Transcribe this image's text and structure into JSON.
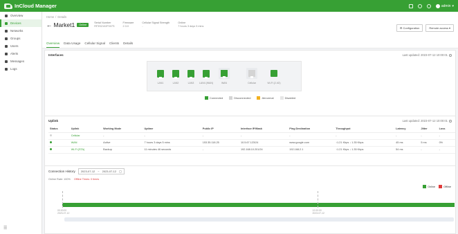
{
  "app": {
    "name": "InCloud Manager",
    "user": "admin"
  },
  "sidebar": {
    "items": [
      {
        "label": "Overview",
        "icon": "dashboard-icon",
        "active": false
      },
      {
        "label": "Devices",
        "icon": "devices-icon",
        "active": true
      },
      {
        "label": "Networks",
        "icon": "network-icon",
        "active": false
      },
      {
        "label": "Groups",
        "icon": "groups-icon",
        "active": false
      },
      {
        "label": "Users",
        "icon": "users-icon",
        "active": false
      },
      {
        "label": "Alerts",
        "icon": "alert-icon",
        "active": false
      },
      {
        "label": "Messages",
        "icon": "message-icon",
        "active": false
      },
      {
        "label": "Logs",
        "icon": "log-icon",
        "active": false
      }
    ],
    "collapse": "☰"
  },
  "header": {
    "breadcrumb": [
      "Home",
      "/",
      "Details"
    ],
    "back": "←",
    "device": "Market1",
    "status": "Online",
    "meta": [
      {
        "label": "Serial Number",
        "value": "RF3S2102F007S"
      },
      {
        "label": "Firmware",
        "value": "2.3.0"
      },
      {
        "label": "Cellular Signal Strength",
        "value": "-"
      },
      {
        "label": "Online",
        "value": "7 hours 3 days 5 mins"
      }
    ],
    "buttons": {
      "config": "⚙ Configuration",
      "remote": "Remote access ▾"
    },
    "tabs": [
      "Overview",
      "Data Usage",
      "Cellular Signal",
      "Clients",
      "Details"
    ],
    "active_tab": "Overview"
  },
  "interfaces": {
    "title": "Interfaces",
    "updated": "Last updated: 2023-07-12 10:00:01",
    "ports": [
      {
        "label": "LAN1",
        "state": "connected"
      },
      {
        "label": "LAN2",
        "state": "connected"
      },
      {
        "label": "LAN3",
        "state": "connected"
      },
      {
        "label": "LAN4 (WAN)",
        "state": "connected"
      },
      {
        "label": "WAN",
        "state": "connected"
      },
      {
        "label": "Cellular",
        "state": "disabled"
      },
      {
        "label": "Wi-Fi (2.4G)",
        "state": "connected"
      }
    ],
    "legend": [
      {
        "label": "Connected",
        "color": "#37a034"
      },
      {
        "label": "Disconnected",
        "color": "#d4d4d4"
      },
      {
        "label": "Abnormal",
        "color": "#f2b01e"
      },
      {
        "label": "Disabled",
        "color": "#e6e6e6"
      }
    ]
  },
  "uplink": {
    "title": "Uplink",
    "updated": "Last updated: 2023-07-12 10:00:01",
    "columns": [
      "Status",
      "Uplink",
      "Working Mode",
      "Uptime",
      "Public IP",
      "Interface IP/Mask",
      "Ping Destination",
      "Throughput",
      "Latency",
      "Jitter",
      "Loss"
    ],
    "rows": [
      [
        "#d4d4d4",
        "Cellular",
        "-",
        "-",
        "-",
        "-",
        "-",
        "-",
        "-",
        "-",
        "-"
      ],
      [
        "#37a034",
        "WAN",
        "Active",
        "7 hours 3 days 5 mins",
        "153.35.118.25",
        "10.5.67.123/24",
        "www.google.com",
        "↑1.21 Kbps ↓ 1.35 Kbps",
        "45 ms",
        "5 ms",
        "0%"
      ],
      [
        "#37a034",
        "Wi-Fi (STA)",
        "Backup",
        "11 minutes 46 seconds",
        "-",
        "192.168.10.201/24",
        "192.168.2.1",
        "↑1.21 Kbps ↓ 1.35 Kbps",
        "54 ms",
        "-",
        "-"
      ]
    ]
  },
  "history": {
    "title": "Connection History",
    "date_from": "2023-07-12",
    "date_sep": "~",
    "date_to": "2023-07-12",
    "online_rate": "Online Rate: 100%",
    "offline_rate": "Offline Times: 0 times",
    "legend_online": "Online",
    "legend_offline": "Offline",
    "ticks": [
      {
        "l1": "00:00:00",
        "l2": "2023-07-12",
        "pos": 0
      },
      {
        "l1": "12:00:00",
        "l2": "2023-07-12",
        "pos": 0.65
      }
    ],
    "colors": {
      "online": "#37a034",
      "offline": "#e03b3b"
    }
  }
}
